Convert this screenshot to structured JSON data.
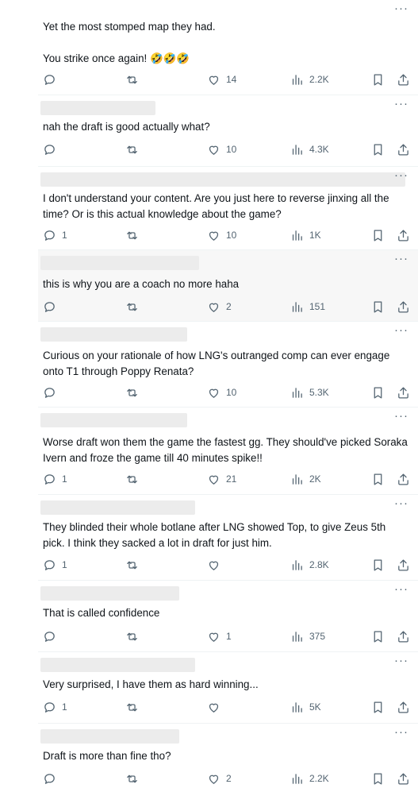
{
  "posts": [
    {
      "lines": [
        "Yet the most stomped map they had.",
        "",
        "You strike once again! 🤣🤣🤣"
      ],
      "replies": "",
      "likes": "14",
      "views": "2.2K"
    },
    {
      "lines": [
        "nah the draft is good actually what?"
      ],
      "replies": "",
      "likes": "10",
      "views": "4.3K"
    },
    {
      "lines": [
        "I don't understand your content. Are you just here to reverse jinxing all the",
        "time? Or is this actual knowledge about the game?"
      ],
      "replies": "1",
      "likes": "10",
      "views": "1K"
    },
    {
      "lines": [
        "this is why you are a coach no more haha"
      ],
      "replies": "",
      "likes": "2",
      "views": "151"
    },
    {
      "lines": [
        "Curious on your rationale of how LNG's outranged comp can ever engage",
        "onto T1 through Poppy Renata?"
      ],
      "replies": "",
      "likes": "10",
      "views": "5.3K"
    },
    {
      "lines": [
        "Worse draft won them the game the fastest gg. They should've picked Soraka",
        "Ivern and froze the game till 40 minutes spike!!"
      ],
      "replies": "1",
      "likes": "21",
      "views": "2K"
    },
    {
      "lines": [
        "They blinded their whole botlane after LNG showed Top, to give Zeus 5th",
        "pick. I think they sacked a lot in draft for just him."
      ],
      "replies": "1",
      "likes": "",
      "views": "2.8K"
    },
    {
      "lines": [
        "That is called confidence"
      ],
      "replies": "",
      "likes": "1",
      "views": "375"
    },
    {
      "lines": [
        "Very surprised, I have them as hard winning..."
      ],
      "replies": "1",
      "likes": "",
      "views": "5K"
    },
    {
      "lines": [
        "Draft is more than fine tho?"
      ],
      "replies": "",
      "likes": "2",
      "views": "2.2K"
    }
  ],
  "icons": [
    "more-icon",
    "reply-icon",
    "retweet-icon",
    "like-icon",
    "views-icon",
    "bookmark-icon",
    "share-icon"
  ],
  "colors": {
    "icon": "#536471",
    "text": "#0f1419",
    "divider": "#eff3f4"
  }
}
